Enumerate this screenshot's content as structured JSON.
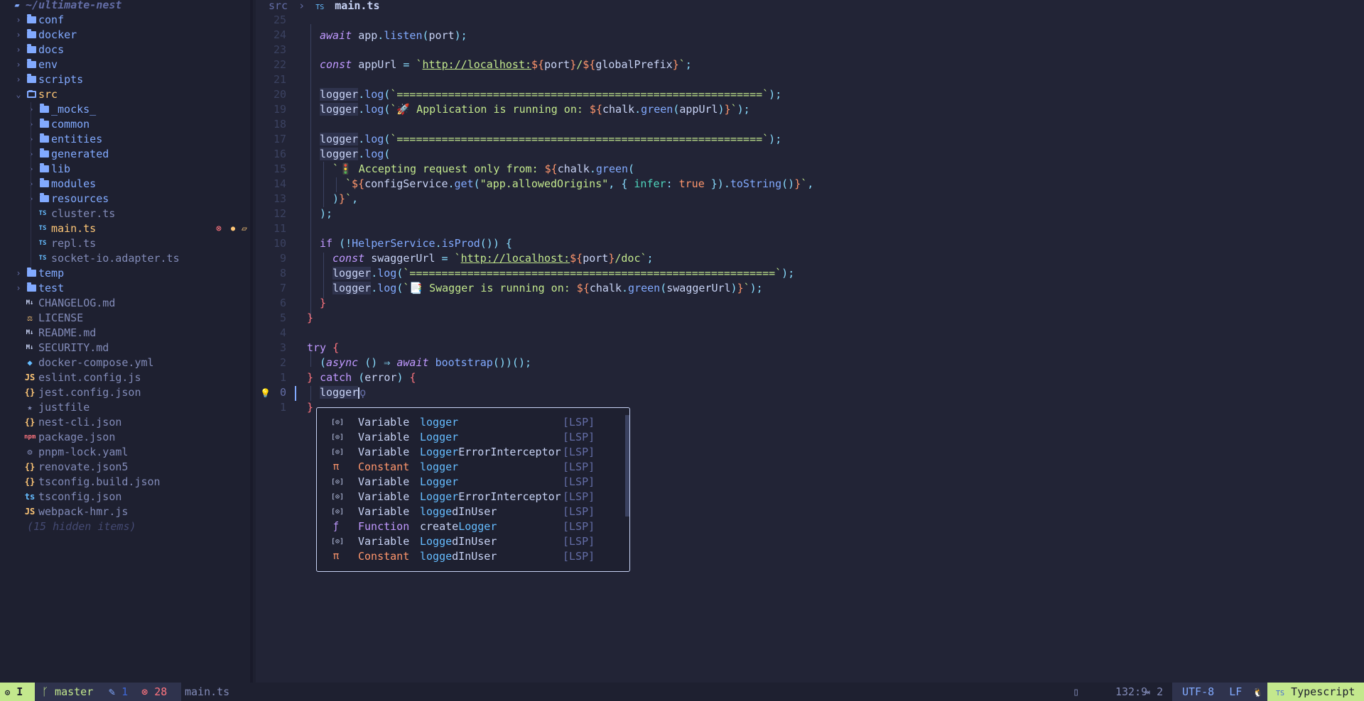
{
  "sidebar": {
    "root": "~/ultimate-nest",
    "items": [
      {
        "name": "conf",
        "type": "folder",
        "depth": 0,
        "open": false
      },
      {
        "name": "docker",
        "type": "folder",
        "depth": 0,
        "open": false
      },
      {
        "name": "docs",
        "type": "folder",
        "depth": 0,
        "open": false
      },
      {
        "name": "env",
        "type": "folder",
        "depth": 0,
        "open": false
      },
      {
        "name": "scripts",
        "type": "folder",
        "depth": 0,
        "open": false
      },
      {
        "name": "src",
        "type": "folder",
        "depth": 0,
        "open": true
      },
      {
        "name": "_mocks_",
        "type": "folder",
        "depth": 1,
        "open": false
      },
      {
        "name": "common",
        "type": "folder",
        "depth": 1,
        "open": false
      },
      {
        "name": "entities",
        "type": "folder",
        "depth": 1,
        "open": false
      },
      {
        "name": "generated",
        "type": "folder",
        "depth": 1,
        "open": false
      },
      {
        "name": "lib",
        "type": "folder",
        "depth": 1,
        "open": false
      },
      {
        "name": "modules",
        "type": "folder",
        "depth": 1,
        "open": false
      },
      {
        "name": "resources",
        "type": "folder",
        "depth": 1,
        "open": false
      },
      {
        "name": "cluster.ts",
        "type": "ts",
        "depth": 1
      },
      {
        "name": "main.ts",
        "type": "ts",
        "depth": 1,
        "active": true
      },
      {
        "name": "repl.ts",
        "type": "ts",
        "depth": 1
      },
      {
        "name": "socket-io.adapter.ts",
        "type": "ts",
        "depth": 1
      },
      {
        "name": "temp",
        "type": "folder",
        "depth": 0,
        "open": false
      },
      {
        "name": "test",
        "type": "folder",
        "depth": 0,
        "open": false
      },
      {
        "name": "CHANGELOG.md",
        "type": "md",
        "depth": 0
      },
      {
        "name": "LICENSE",
        "type": "license",
        "depth": 0
      },
      {
        "name": "README.md",
        "type": "md",
        "depth": 0
      },
      {
        "name": "SECURITY.md",
        "type": "md",
        "depth": 0
      },
      {
        "name": "docker-compose.yml",
        "type": "docker",
        "depth": 0
      },
      {
        "name": "eslint.config.js",
        "type": "js",
        "depth": 0
      },
      {
        "name": "jest.config.json",
        "type": "json",
        "depth": 0
      },
      {
        "name": "justfile",
        "type": "just",
        "depth": 0
      },
      {
        "name": "nest-cli.json",
        "type": "json",
        "depth": 0
      },
      {
        "name": "package.json",
        "type": "npm",
        "depth": 0
      },
      {
        "name": "pnpm-lock.yaml",
        "type": "gear",
        "depth": 0
      },
      {
        "name": "renovate.json5",
        "type": "json",
        "depth": 0
      },
      {
        "name": "tsconfig.build.json",
        "type": "json",
        "depth": 0
      },
      {
        "name": "tsconfig.json",
        "type": "tsconfig",
        "depth": 0
      },
      {
        "name": "webpack-hmr.js",
        "type": "js",
        "depth": 0
      }
    ],
    "hidden": "(15 hidden items)",
    "icon_text": {
      "ts": "TS",
      "js": "JS",
      "json": "{}",
      "license": "⚖",
      "just": "★",
      "gear": "⚙",
      "npm": "npm",
      "docker": "◆",
      "md": "M↓",
      "tsconfig": "ts"
    },
    "active_markers": {
      "error": "⊗",
      "modified": "●",
      "unsaved": "▱"
    }
  },
  "breadcrumb": {
    "folder": "src",
    "separator": "›",
    "icon": "TS",
    "file": "main.ts"
  },
  "editor": {
    "line_numbers": [
      "25",
      "24",
      "23",
      "22",
      "21",
      "20",
      "19",
      "18",
      "17",
      "16",
      "15",
      "14",
      "13",
      "12",
      "11",
      "10",
      "9",
      "8",
      "7",
      "6",
      "5",
      "4",
      "3",
      "2",
      "1",
      "0",
      "1"
    ],
    "cursor_line_index": 25,
    "lightbulb": "💡"
  },
  "code": {
    "l24": {
      "await": "await",
      "app": "app",
      "listen": "listen",
      "port": "port"
    },
    "l22": {
      "const": "const",
      "var": "appUrl",
      "eq": "=",
      "url": "http://localhost:",
      "p1": "port",
      "p2": "globalPrefix"
    },
    "log": "logger",
    "logfn": "log",
    "sep_str": "=========================================================",
    "l19_text": "🚀 Application is running on: ",
    "chalk": "chalk",
    "green": "green",
    "appUrl": "appUrl",
    "l15_text": "🚦 Accepting request only from: ",
    "configService": "configService",
    "get": "get",
    "allowed": "\"app.allowedOrigins\"",
    "infer": "infer",
    "true": "true",
    "toString": "toString",
    "if": "if",
    "Helper": "HelperService",
    "isProd": "isProd",
    "swaggerUrl": "swaggerUrl",
    "swagger_url": "http://localhost:",
    "doc": "/doc",
    "l7_text": "📑 Swagger is running on: ",
    "try": "try",
    "async": "async",
    "bootstrap": "bootstrap",
    "catch": "catch",
    "error": "error",
    "typed": "logger"
  },
  "completion": {
    "items": [
      {
        "icon": "[⊙]",
        "kind": "Variable",
        "match": "logger",
        "rest": "",
        "source": "[LSP]",
        "kind_color": "#c8d3f5",
        "icon_color": "#c8d3f5"
      },
      {
        "icon": "[⊙]",
        "kind": "Variable",
        "match": "Logger",
        "rest": "",
        "source": "[LSP]",
        "kind_color": "#c8d3f5",
        "icon_color": "#c8d3f5"
      },
      {
        "icon": "[⊙]",
        "kind": "Variable",
        "match": "Logger",
        "rest": "ErrorInterceptor",
        "source": "[LSP]",
        "kind_color": "#c8d3f5",
        "icon_color": "#c8d3f5"
      },
      {
        "icon": "π",
        "kind": "Constant",
        "match": "logger",
        "rest": "",
        "source": "[LSP]",
        "kind_color": "#ff966c",
        "icon_color": "#ff966c"
      },
      {
        "icon": "[⊙]",
        "kind": "Variable",
        "match": "Logger",
        "rest": "",
        "source": "[LSP]",
        "kind_color": "#c8d3f5",
        "icon_color": "#c8d3f5"
      },
      {
        "icon": "[⊙]",
        "kind": "Variable",
        "match": "Logger",
        "rest": "ErrorInterceptor",
        "source": "[LSP]",
        "kind_color": "#c8d3f5",
        "icon_color": "#c8d3f5"
      },
      {
        "icon": "[⊙]",
        "kind": "Variable",
        "match": "logge",
        "rest": "dInUser",
        "source": "[LSP]",
        "kind_color": "#c8d3f5",
        "icon_color": "#c8d3f5"
      },
      {
        "icon": "ƒ",
        "kind": "Function",
        "match": "",
        "rest": "createLogger",
        "source": "[LSP]",
        "kind_color": "#c099ff",
        "icon_color": "#c099ff",
        "prefix": "create",
        "m2": "Logger"
      },
      {
        "icon": "[⊙]",
        "kind": "Variable",
        "match": "Logge",
        "rest": "dInUser",
        "source": "[LSP]",
        "kind_color": "#c8d3f5",
        "icon_color": "#c8d3f5"
      },
      {
        "icon": "π",
        "kind": "Constant",
        "match": "logge",
        "rest": "dInUser",
        "source": "[LSP]",
        "kind_color": "#ff966c",
        "icon_color": "#ff966c"
      }
    ]
  },
  "statusbar": {
    "mode": "I",
    "mode_icon": "⊙",
    "branch_icon": "ᚴ",
    "branch": "master",
    "diag_warn_icon": "✎",
    "diag_warn": "1",
    "diag_err_icon": "⊗",
    "diag_err": "28",
    "filename": "main.ts",
    "file_icon": "▯",
    "position": "132:9",
    "indent_icon": "⇥",
    "indent": "2",
    "encoding": "UTF-8",
    "eol": "LF",
    "os_icon": "🐧",
    "lang_icon": "TS",
    "language": "Typescript"
  },
  "colors": {
    "accent_blue": "#82aaff",
    "mode_green": "#c3e88d",
    "error": "#ff757f",
    "warning": "#ffc777",
    "bg": "#222436",
    "sidebar_bg": "#1e2030"
  }
}
